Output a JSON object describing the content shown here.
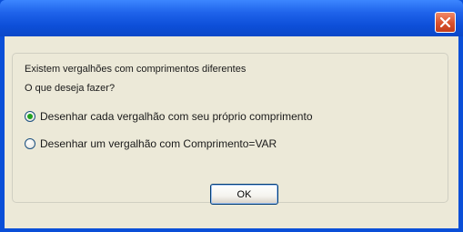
{
  "window": {
    "title": "",
    "close_icon": "close-icon"
  },
  "dialog": {
    "message_line1": "Existem vergalhões com comprimentos diferentes",
    "message_line2": "O que deseja fazer?",
    "options": [
      {
        "label": "Desenhar cada vergalhão com seu próprio comprimento",
        "checked": true
      },
      {
        "label": "Desenhar um vergalhão com Comprimento=VAR",
        "checked": false
      }
    ],
    "ok_label": "OK"
  },
  "colors": {
    "titlebar": "#0a4fd8",
    "client_bg": "#ece9d8",
    "close_button": "#d9512d",
    "radio_dot": "#21a121"
  }
}
